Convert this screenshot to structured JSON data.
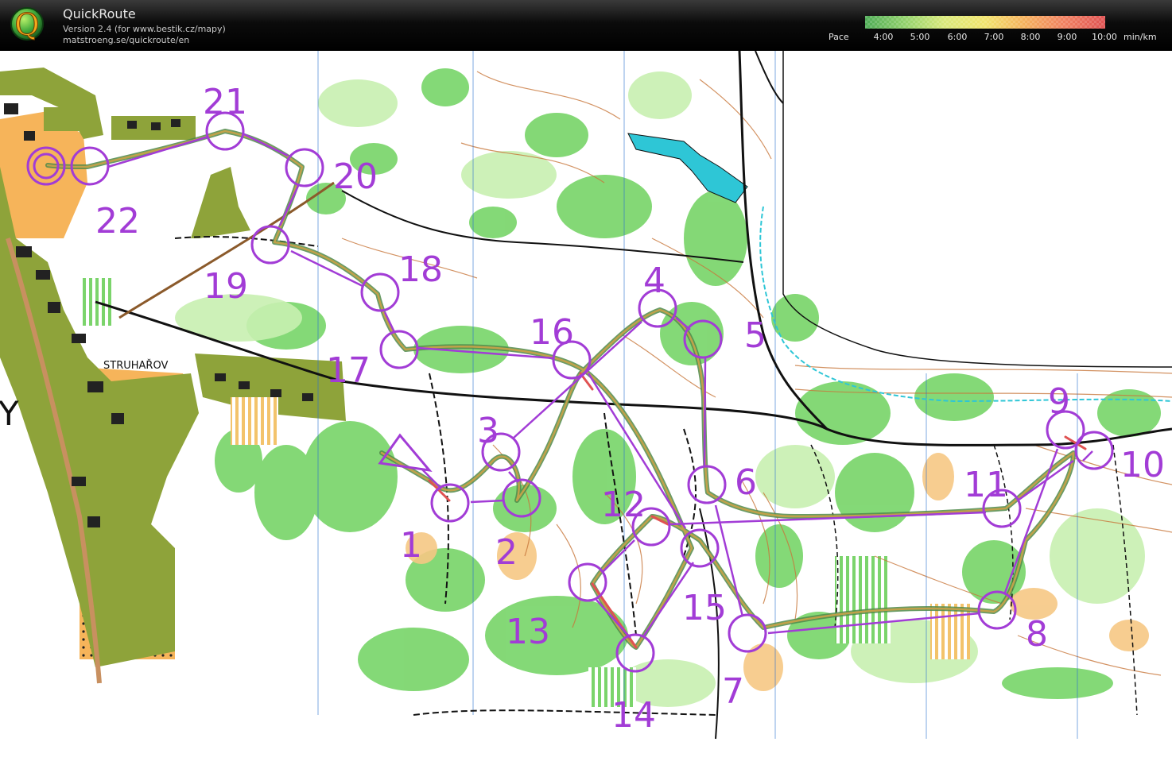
{
  "app": {
    "name": "QuickRoute",
    "version": "Version 2.4  (for www.bestik.cz/mapy)",
    "url": "matstroeng.se/quickroute/en",
    "logo_letter": "Q",
    "logo_icon": "quickroute-logo-icon"
  },
  "pace_legend": {
    "label": "Pace",
    "unit": "min/km",
    "ticks": [
      "4:00",
      "5:00",
      "6:00",
      "7:00",
      "8:00",
      "9:00",
      "10:00"
    ],
    "colors": [
      "#4dab55",
      "#8fd06a",
      "#d9e97a",
      "#f2e46d",
      "#f5b25c",
      "#f08060",
      "#e05252"
    ]
  },
  "map": {
    "place_label": "STRUHAŘOV",
    "edge_letter": "Y",
    "course_color": "#a23cd6",
    "route_color": "#4f8a4a",
    "controls": [
      "1",
      "2",
      "3",
      "4",
      "5",
      "6",
      "7",
      "8",
      "9",
      "10",
      "11",
      "12",
      "13",
      "14",
      "15",
      "16",
      "17",
      "18",
      "19",
      "20",
      "21",
      "22"
    ]
  }
}
